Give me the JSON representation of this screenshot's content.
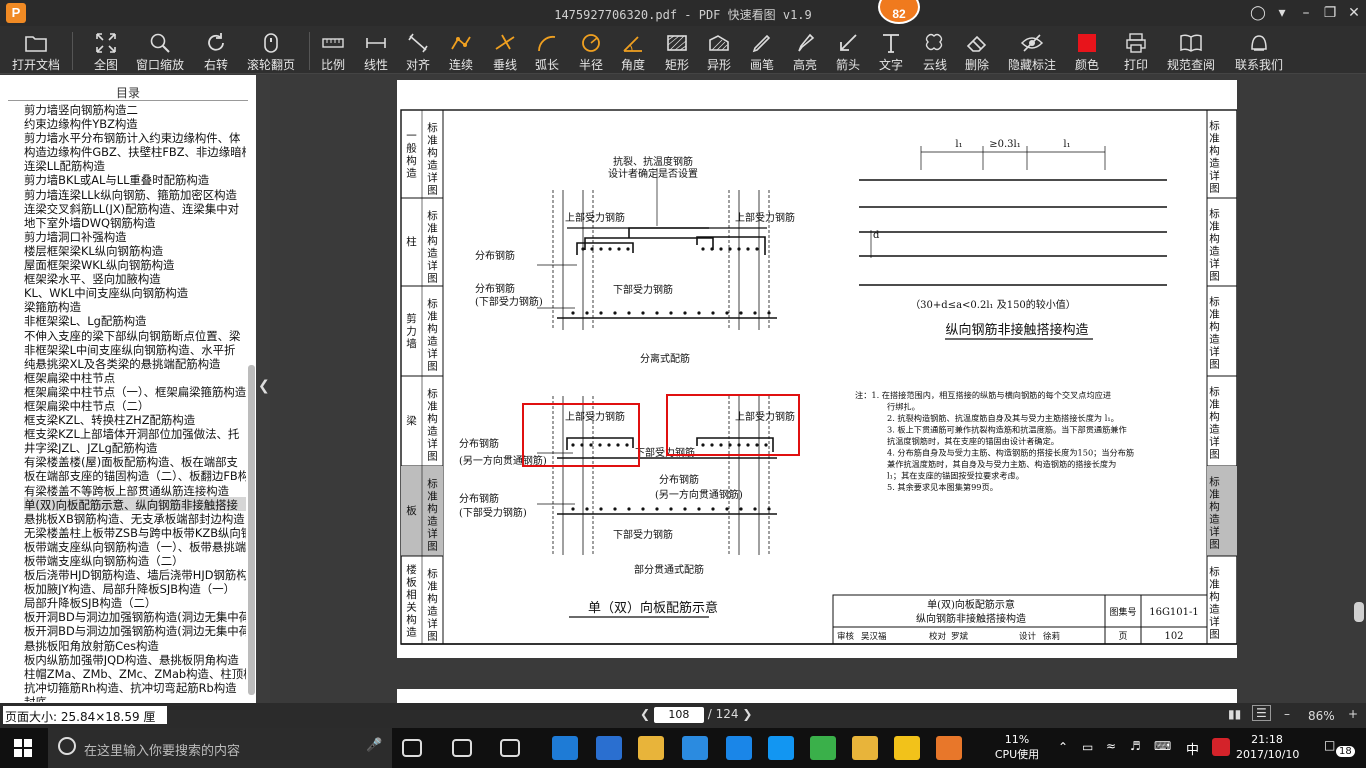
{
  "titlebar": {
    "logo": "P",
    "title": "1475927706320.pdf - PDF 快速看图 v1.9",
    "badge": "82"
  },
  "toolbar": {
    "items": [
      {
        "label": "打开文档",
        "icon": "folder-icon"
      },
      {
        "label": "全图",
        "icon": "fit-all-icon"
      },
      {
        "label": "窗口缩放",
        "icon": "zoom-window-icon"
      },
      {
        "label": "右转",
        "icon": "rotate-right-icon"
      },
      {
        "label": "滚轮翻页",
        "icon": "mouse-wheel-icon"
      },
      {
        "label": "比例",
        "icon": "ruler-scale-icon"
      },
      {
        "label": "线性",
        "icon": "linear-measure-icon"
      },
      {
        "label": "对齐",
        "icon": "aligned-measure-icon"
      },
      {
        "label": "连续",
        "icon": "continuous-measure-icon"
      },
      {
        "label": "垂线",
        "icon": "perpendicular-icon"
      },
      {
        "label": "弧长",
        "icon": "arc-length-icon"
      },
      {
        "label": "半径",
        "icon": "radius-icon"
      },
      {
        "label": "角度",
        "icon": "angle-icon"
      },
      {
        "label": "矩形",
        "icon": "rectangle-icon"
      },
      {
        "label": "异形",
        "icon": "polygon-icon"
      },
      {
        "label": "画笔",
        "icon": "pen-icon"
      },
      {
        "label": "高亮",
        "icon": "highlighter-icon"
      },
      {
        "label": "箭头",
        "icon": "arrow-icon"
      },
      {
        "label": "文字",
        "icon": "text-icon"
      },
      {
        "label": "云线",
        "icon": "cloud-line-icon"
      },
      {
        "label": "删除",
        "icon": "eraser-icon"
      },
      {
        "label": "隐藏标注",
        "icon": "hide-annotation-icon"
      },
      {
        "label": "颜色",
        "icon": "color-swatch-icon"
      },
      {
        "label": "打印",
        "icon": "printer-icon"
      },
      {
        "label": "规范查阅",
        "icon": "book-icon"
      },
      {
        "label": "联系我们",
        "icon": "contact-icon"
      }
    ],
    "swatch_color": "#e8141b"
  },
  "sidebar": {
    "title": "目录",
    "items": [
      "剪力墙竖向钢筋构造二",
      "约束边缘构件YBZ构造",
      "剪力墙水平分布钢筋计入约束边缘构件、体",
      "构造边缘构件GBZ、扶壁柱FBZ、非边缘暗柱",
      "连梁LL配筋构造",
      "剪力墙BKL或AL与LL重叠时配筋构造",
      "剪力墙连梁LLk纵向钢筋、箍筋加密区构造",
      "连梁交叉斜筋LL(JX)配筋构造、连梁集中对",
      "地下室外墙DWQ钢筋构造",
      "剪力墙洞口补强构造",
      "楼层框架梁KL纵向钢筋构造",
      "屋面框架梁WKL纵向钢筋构造",
      "框架梁水平、竖向加腋构造",
      "KL、WKL中间支座纵向钢筋构造",
      "梁箍筋构造",
      "非框架梁L、Lg配筋构造",
      "不伸入支座的梁下部纵向钢筋断点位置、梁",
      "非框架梁L中间支座纵向钢筋构造、水平折",
      "纯悬挑梁XL及各类梁的悬挑端配筋构造",
      "框架扁梁中柱节点",
      "框架扁梁中柱节点（一）、框架扁梁箍筋构造",
      "框架扁梁中柱节点（二）",
      "框支梁KZL、转换柱ZHZ配筋构造",
      "框支梁KZL上部墙体开洞部位加强做法、托",
      "井字梁JZL、JZLg配筋构造",
      "有梁楼盖楼(屋)面板配筋构造、板在端部支",
      "板在端部支座的锚固构造（二）、板翻边FB构",
      "有梁楼盖不等跨板上部贯通纵筋连接构造",
      "单(双)向板配筋示意、纵向钢筋非接触搭接",
      "悬挑板XB钢筋构造、无支承板端部封边构造",
      "无梁楼盖柱上板带ZSB与跨中板带KZB纵向钢",
      "板带端支座纵向钢筋构造（一）、板带悬挑端",
      "板带端支座纵向钢筋构造（二）",
      "板后浇带HJD钢筋构造、墙后浇带HJD钢筋构",
      "板加腋JY构造、局部升降板SJB构造（一）",
      "局部升降板SJB构造（二）",
      "板开洞BD与洞边加强钢筋构造(洞边无集中荷",
      "板开洞BD与洞边加强钢筋构造(洞边无集中荷",
      "悬挑板阳角放射筋Ces构造",
      "板内纵筋加强带JQD构造、悬挑板阴角构造",
      "柱帽ZMa、ZMb、ZMc、ZMab构造、柱顶柱帽",
      "抗冲切箍筋Rh构造、抗冲切弯起筋Rb构造",
      "封底"
    ],
    "selected_index": 28
  },
  "drawing": {
    "left_tabs": [
      "一般构造",
      "柱",
      "剪力墙",
      "梁",
      "板",
      "楼板相关构造"
    ],
    "tab_suffix": "标准构造详图",
    "active_tab": 4,
    "right_tabs": [
      "一般构造",
      "柱",
      "剪力墙",
      "梁",
      "板",
      "楼板相关构造"
    ],
    "labels": {
      "crack_bars": "抗裂、抗温度钢筋",
      "crack_bars2": "设计者确定是否设置",
      "top_bars": "上部受力钢筋",
      "dist_bars": "分布钢筋",
      "bottom_bars": "下部受力钢筋",
      "dist_bottom": "(下部受力钢筋)",
      "separated": "分离式配筋",
      "other_through": "(另一方向贯通钢筋)",
      "partial_through": "部分贯通式配筋",
      "main_title": "单（双）向板配筋示意",
      "lap_title": "纵向钢筋非接触搭接构造",
      "lap_note": "（30+d≤a<0.2l₁ 及150的较小值）",
      "dim_l1": "l₁",
      "dim_03": "≥0.3l₁",
      "dim_d": "d"
    },
    "notes": [
      "注：1. 在搭接范围内，相互搭接的纵筋与横向钢筋的每个交叉点均应进",
      "行绑扎。",
      "2. 抗裂构造钢筋、抗温度筋自身及其与受力主筋搭接长度为 l₁。",
      "3. 板上下贯通筋可兼作抗裂构造筋和抗温度筋。当下部贯通筋兼作",
      "抗温度钢筋时，其在支座的锚固由设计者确定。",
      "4. 分布筋自身及与受力主筋、构造钢筋的搭接长度为150；当分布筋",
      "兼作抗温度筋时，其自身及与受力主筋、构造钢筋的搭接长度为",
      "l₁；其在支座的锚固按受拉要求考虑。",
      "5. 其余要求见本图集第99页。"
    ],
    "titleblock": {
      "title1": "单(双)向板配筋示意",
      "title2": "纵向钢筋非接触搭接构造",
      "atlas_label": "图集号",
      "atlas_no": "16G101-1",
      "review": "审核",
      "reviewer": "吴汉福",
      "check": "校对",
      "checker": "罗斌",
      "design": "设计",
      "designer": "徐莉",
      "page_label": "页",
      "page_no": "102"
    }
  },
  "statusbar": {
    "page_size": "页面大小: 25.84×18.59 厘米",
    "current_page": "108",
    "total_pages": "/ 124",
    "zoom": "86%"
  },
  "taskbar": {
    "search_placeholder": "在这里输入你要搜索的内容",
    "cpu_percent": "11%",
    "cpu_label": "CPU使用",
    "ime": "中",
    "time": "21:18",
    "date": "2017/10/10",
    "notifications": "18"
  }
}
